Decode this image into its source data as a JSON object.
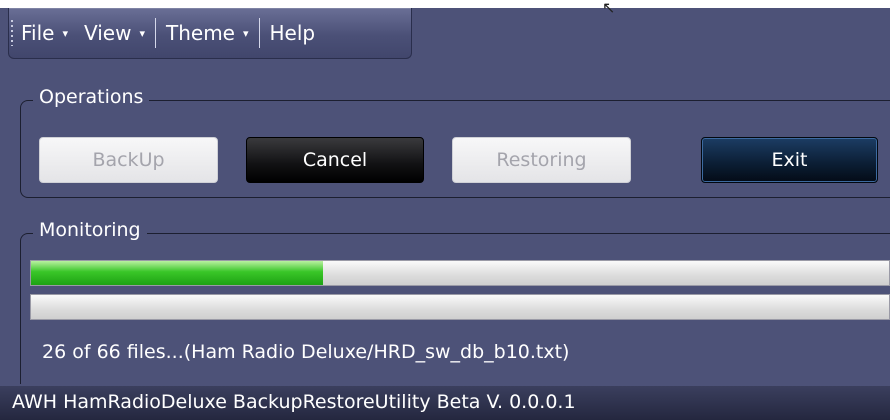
{
  "menubar": {
    "items": [
      {
        "label": "File",
        "caret": "▾"
      },
      {
        "label": "View",
        "caret": "▾"
      },
      {
        "label": "Theme",
        "caret": "▾"
      },
      {
        "label": "Help"
      }
    ]
  },
  "operations": {
    "title": "Operations",
    "buttons": {
      "backup": "BackUp",
      "cancel": "Cancel",
      "restoring": "Restoring",
      "exit": "Exit"
    }
  },
  "monitoring": {
    "title": "Monitoring",
    "overall_progress_percent": 34,
    "file_progress_percent": 0,
    "status_text": "26 of 66 files...(Ham Radio Deluxe/HRD_sw_db_b10.txt)"
  },
  "window": {
    "title": "AWH HamRadioDeluxe BackupRestoreUtility Beta V. 0.0.0.1"
  },
  "colors": {
    "background": "#4d5278",
    "progress_fill": "#39c628",
    "exit_button": "#0b1d33"
  },
  "icons": {
    "menu_grip": "menu-grip-icon",
    "dropdown": "chevron-down-icon",
    "cursor": "mouse-cursor-icon"
  }
}
